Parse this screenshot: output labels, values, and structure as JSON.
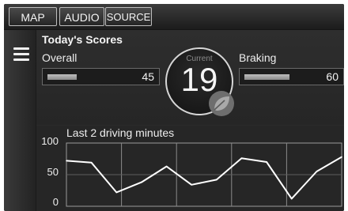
{
  "nav": {
    "tabs": [
      {
        "label": "MAP"
      },
      {
        "label": "AUDIO"
      },
      {
        "label": "SOURCE"
      }
    ]
  },
  "scores": {
    "title": "Today's Scores",
    "overall": {
      "label": "Overall",
      "value": "45",
      "fill": 0.45
    },
    "current": {
      "label": "Current",
      "value": "19"
    },
    "braking": {
      "label": "Braking",
      "value": "60",
      "fill": 0.6
    }
  },
  "history": {
    "title": "Last 2 driving minutes"
  },
  "chart_data": {
    "type": "line",
    "title": "Last 2 driving minutes",
    "ylim": [
      0,
      100
    ],
    "y_ticks": [
      "100",
      "50",
      "0"
    ],
    "grid": true,
    "x": [
      0,
      1,
      2,
      3,
      4,
      5,
      6,
      7,
      8,
      9,
      10,
      11
    ],
    "series": [
      {
        "values": [
          72,
          69,
          22,
          38,
          63,
          34,
          42,
          76,
          70,
          12,
          55,
          78
        ]
      }
    ]
  },
  "icons": {
    "menu": "menu-icon",
    "leaf": "leaf-icon"
  },
  "colors": {
    "line": "#ffffff",
    "grid": "#8a8a8a",
    "background": "#2a2a2a"
  }
}
